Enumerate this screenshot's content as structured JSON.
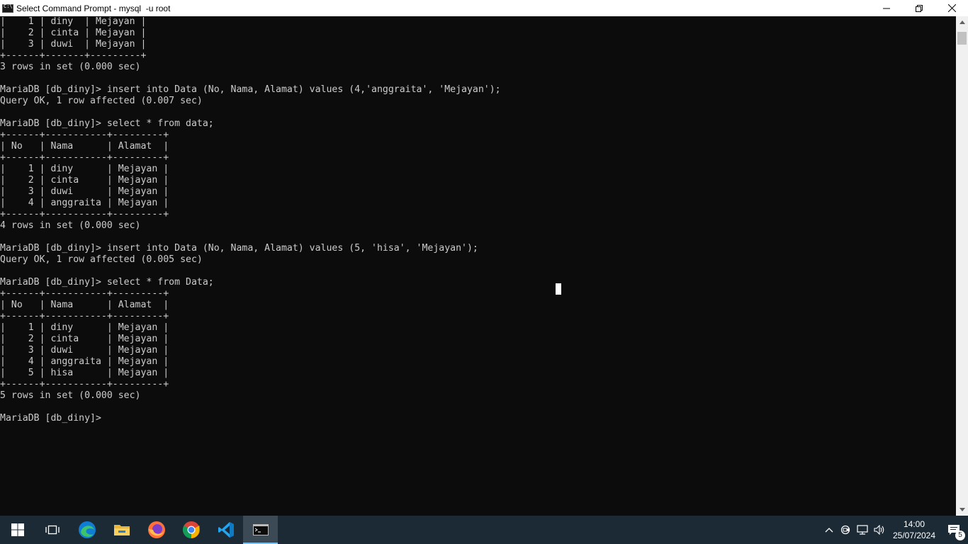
{
  "window": {
    "title": "Select Command Prompt - mysql  -u root",
    "minimize_glyph": "—",
    "maximize_glyph": "❐",
    "close_glyph": "✕"
  },
  "terminal": {
    "lines": [
      "|    1 | diny  | Mejayan |",
      "|    2 | cinta | Mejayan |",
      "|    3 | duwi  | Mejayan |",
      "+------+-------+---------+",
      "3 rows in set (0.000 sec)",
      "",
      "MariaDB [db_diny]> insert into Data (No, Nama, Alamat) values (4,'anggraita', 'Mejayan');",
      "Query OK, 1 row affected (0.007 sec)",
      "",
      "MariaDB [db_diny]> select * from data;",
      "+------+-----------+---------+",
      "| No   | Nama      | Alamat  |",
      "+------+-----------+---------+",
      "|    1 | diny      | Mejayan |",
      "|    2 | cinta     | Mejayan |",
      "|    3 | duwi      | Mejayan |",
      "|    4 | anggraita | Mejayan |",
      "+------+-----------+---------+",
      "4 rows in set (0.000 sec)",
      "",
      "MariaDB [db_diny]> insert into Data (No, Nama, Alamat) values (5, 'hisa', 'Mejayan');",
      "Query OK, 1 row affected (0.005 sec)",
      "",
      "MariaDB [db_diny]> select * from Data;",
      "+------+-----------+---------+",
      "| No   | Nama      | Alamat  |",
      "+------+-----------+---------+",
      "|    1 | diny      | Mejayan |",
      "|    2 | cinta     | Mejayan |",
      "|    3 | duwi      | Mejayan |",
      "|    4 | anggraita | Mejayan |",
      "|    5 | hisa      | Mejayan |",
      "+------+-----------+---------+",
      "5 rows in set (0.000 sec)",
      "",
      "MariaDB [db_diny]> "
    ]
  },
  "taskbar": {
    "apps": [
      {
        "name": "start-button",
        "icon": "windows-logo-icon"
      },
      {
        "name": "task-view-button",
        "icon": "task-view-icon"
      },
      {
        "name": "edge-button",
        "icon": "edge-icon"
      },
      {
        "name": "file-explorer-button",
        "icon": "folder-icon"
      },
      {
        "name": "firefox-button",
        "icon": "firefox-icon"
      },
      {
        "name": "chrome-button",
        "icon": "chrome-icon"
      },
      {
        "name": "vscode-button",
        "icon": "vscode-icon"
      },
      {
        "name": "command-prompt-button",
        "icon": "cmd-icon"
      }
    ],
    "tray": {
      "chevron_glyph": "^",
      "clock_time": "14:00",
      "clock_date": "25/07/2024",
      "notification_count": "5"
    }
  },
  "colors": {
    "terminal_bg": "#0c0c0c",
    "terminal_fg": "#cccccc",
    "taskbar_bg": "#1c2a35",
    "titlebar_bg": "#ffffff"
  }
}
